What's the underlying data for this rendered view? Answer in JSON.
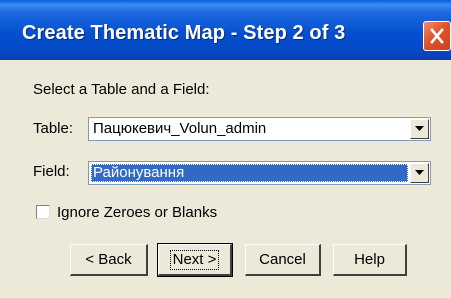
{
  "window": {
    "title": "Create Thematic Map - Step 2 of 3"
  },
  "form": {
    "instruction": "Select a Table and a Field:",
    "table_label": "Table:",
    "table_value": "Пацюкевич_Volun_admin",
    "field_label": "Field:",
    "field_value": "Районування",
    "ignore_label": "Ignore Zeroes or Blanks",
    "ignore_checked": false
  },
  "buttons": {
    "back": "< Back",
    "next": "Next >",
    "cancel": "Cancel",
    "help": "Help"
  },
  "icons": {
    "close": "close-icon",
    "dropdown": "chevron-down-icon"
  },
  "colors": {
    "titlebar": "#0550d0",
    "selection": "#316ac5",
    "close": "#e0542c",
    "dialog_bg": "#ece9d8"
  }
}
